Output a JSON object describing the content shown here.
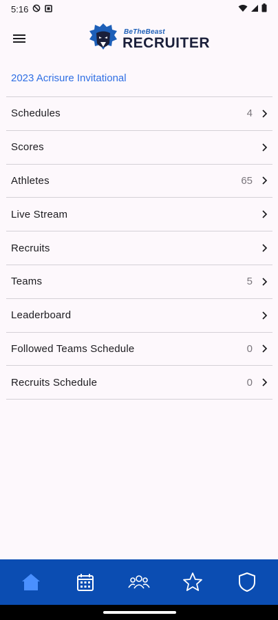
{
  "status_bar": {
    "time": "5:16",
    "icons": [
      "do-not-disturb-icon",
      "notification-icon",
      "wifi-icon",
      "signal-icon",
      "battery-icon"
    ]
  },
  "app_bar": {
    "menu_icon": "hamburger-menu-icon",
    "logo": {
      "tagline": "BeTheBeast",
      "name": "RECRUITER"
    }
  },
  "event_title": "2023 Acrisure Invitational",
  "menu_items": [
    {
      "label": "Schedules",
      "count": "4"
    },
    {
      "label": "Scores",
      "count": ""
    },
    {
      "label": "Athletes",
      "count": "65"
    },
    {
      "label": "Live Stream",
      "count": ""
    },
    {
      "label": "Recruits",
      "count": ""
    },
    {
      "label": "Teams",
      "count": "5"
    },
    {
      "label": "Leaderboard",
      "count": ""
    },
    {
      "label": "Followed Teams Schedule",
      "count": "0"
    },
    {
      "label": "Recruits Schedule",
      "count": "0"
    }
  ],
  "bottom_nav": [
    "home-icon",
    "calendar-icon",
    "people-icon",
    "star-icon",
    "shield-icon"
  ],
  "colors": {
    "background": "#fdf8fc",
    "accent_blue": "#2f6fe4",
    "nav_blue": "#0b4db2",
    "logo_blue": "#1d5fb8",
    "divider": "#d4d0d6",
    "count_gray": "#7a767c"
  }
}
